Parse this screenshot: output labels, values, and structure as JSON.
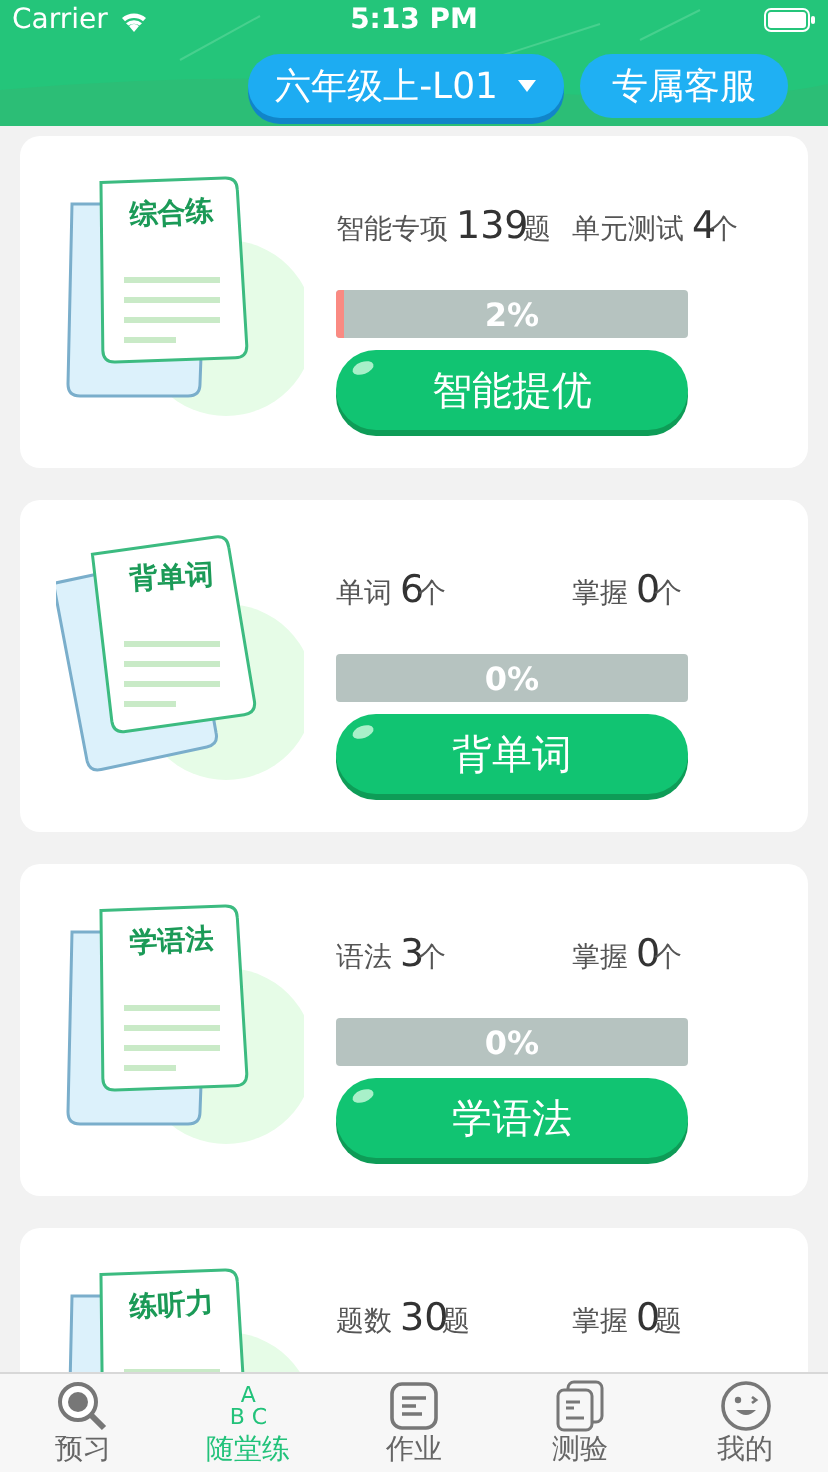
{
  "status_bar": {
    "carrier": "Carrier",
    "time": "5:13 PM"
  },
  "header": {
    "grade_selector": "六年级上-L01",
    "service_button": "专属客服"
  },
  "cards": [
    {
      "title": "综合练",
      "stats": [
        {
          "label": "智能专项",
          "value": "139",
          "unit": "题"
        },
        {
          "label": "单元测试",
          "value": "4",
          "unit": "个"
        }
      ],
      "progress": {
        "level": 0.02,
        "reading": "2%"
      },
      "button": "智能提优"
    },
    {
      "title": "背单词",
      "stats": [
        {
          "label": "单词",
          "value": "6",
          "unit": "个"
        },
        {
          "label": "掌握",
          "value": "0",
          "unit": "个"
        }
      ],
      "progress": {
        "level": 0,
        "reading": "0%"
      },
      "button": "背单词"
    },
    {
      "title": "学语法",
      "stats": [
        {
          "label": "语法",
          "value": "3",
          "unit": "个"
        },
        {
          "label": "掌握",
          "value": "0",
          "unit": "个"
        }
      ],
      "progress": {
        "level": 0,
        "reading": "0%"
      },
      "button": "学语法"
    },
    {
      "title": "练听力",
      "stats": [
        {
          "label": "题数",
          "value": "30",
          "unit": "题"
        },
        {
          "label": "掌握",
          "value": "0",
          "unit": "题"
        }
      ]
    }
  ],
  "tabs": [
    {
      "kind": "search",
      "label": "预习",
      "selected": false
    },
    {
      "kind": "letters",
      "letters": [
        "A",
        "B C"
      ],
      "label": "随堂练",
      "selected": true
    },
    {
      "kind": "list",
      "label": "作业",
      "selected": false
    },
    {
      "kind": "test",
      "label": "测验",
      "selected": false
    },
    {
      "kind": "face",
      "label": "我的",
      "selected": false
    }
  ]
}
